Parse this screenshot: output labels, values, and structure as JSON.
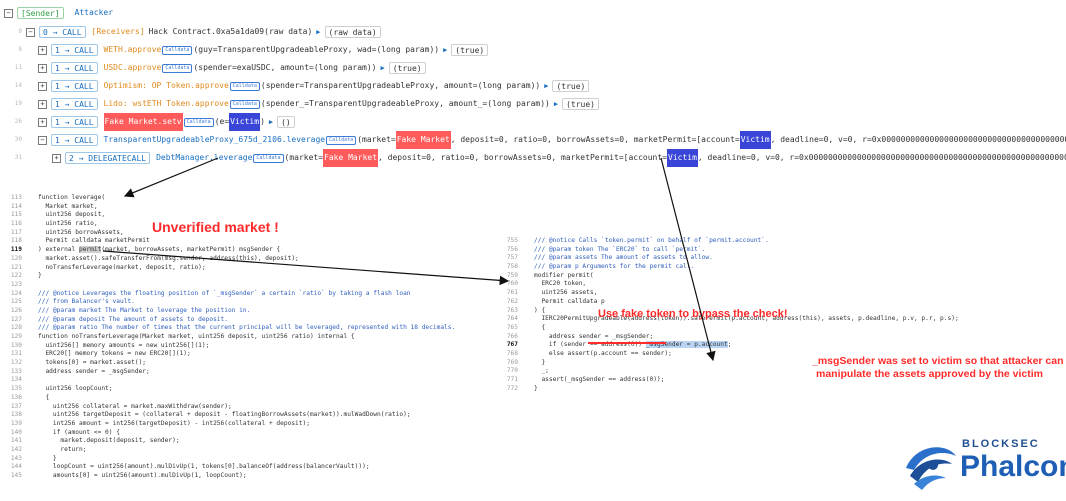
{
  "colors": {
    "accent_blue": "#1a6ec0",
    "call_orange": "#e08a1e",
    "highlight_red": "#ff5b5b",
    "highlight_victim": "#3845d6",
    "annotation_red": "#ff2a2a",
    "brand_blue": "#1e5fb5"
  },
  "trace": {
    "header": {
      "sender": "[Sender]",
      "attacker": "Attacker"
    },
    "calldata_badge": "Calldata",
    "rows": [
      {
        "line": "0",
        "toggle": "−",
        "idx": "0",
        "op": "CALL",
        "head": "[Receivers]",
        "fn": "Hack Contract.0xa5a1da09",
        "args": "(raw data)",
        "ret": "(raw data)"
      },
      {
        "line": "8",
        "toggle": "+",
        "idx": "1",
        "op": "CALL",
        "fn": "WETH.approve",
        "args": "(guy=TransparentUpgradeableProxy, wad=(long param))",
        "ret": "(true)"
      },
      {
        "line": "11",
        "toggle": "+",
        "idx": "1",
        "op": "CALL",
        "fn": "USDC.approve",
        "args": "(spender=exaUSDC, amount=(long param))",
        "ret": "(true)"
      },
      {
        "line": "14",
        "toggle": "+",
        "idx": "1",
        "op": "CALL",
        "fn": "Optimism: OP Token.approve",
        "args": "(spender=TransparentUpgradeableProxy, amount=(long param))",
        "ret": "(true)"
      },
      {
        "line": "19",
        "toggle": "+",
        "idx": "1",
        "op": "CALL",
        "fn": "Lido: wstETH Token.approve",
        "args": "(spender_=TransparentUpgradeableProxy, amount_=(long param))",
        "ret": "(true)"
      },
      {
        "line": "26",
        "toggle": "+",
        "idx": "1",
        "op": "CALL",
        "fn": "Fake Market.setv",
        "args_pre": "(e=",
        "args_victim": "Victim",
        "args_post": ")",
        "ret": "()"
      },
      {
        "line": "30",
        "toggle": "−",
        "idx": "1",
        "op": "CALL",
        "fn": "TransparentUpgradeableProxy_675d_2106.leverage",
        "a1": "(market=",
        "a2": "Fake Market",
        "a3": ", deposit=0, ratio=0, borrowAssets=0, marketPermit=[account=",
        "a4": "Victim",
        "a5": ", deadline=0, v=0, r=0x000000000000000000000000000000000000000000000000000000"
      },
      {
        "line": "31",
        "toggle": "+",
        "idx": "2",
        "op": "DELEGATECALL",
        "fn": "DebtManager.leverage",
        "a1": "(market=",
        "a2": "Fake Market",
        "a3": ", deposit=0, ratio=0, borrowAssets=0, marketPermit=[account=",
        "a4": "Victim",
        "a5": ", deadline=0, v=0, r=0x000000000000000000000000000000000000000000000000000000"
      }
    ]
  },
  "code_left": {
    "lines": [
      {
        "n": "113",
        "t": "function leverage("
      },
      {
        "n": "114",
        "t": "  Market market,"
      },
      {
        "n": "115",
        "t": "  uint256 deposit,"
      },
      {
        "n": "116",
        "t": "  uint256 ratio,"
      },
      {
        "n": "117",
        "t": "  uint256 borrowAssets,"
      },
      {
        "n": "118",
        "t": "  Permit calldata marketPermit"
      },
      {
        "n": "119",
        "t": ") external permit(market, borrowAssets, marketPermit) msgSender {"
      },
      {
        "n": "120",
        "t": "  market.asset().safeTransferFrom(msg.sender, address(this), deposit);"
      },
      {
        "n": "121",
        "t": "  noTransferLeverage(market, deposit, ratio);"
      },
      {
        "n": "122",
        "t": "}"
      },
      {
        "n": "123",
        "t": ""
      },
      {
        "n": "124",
        "t": "/// @notice Leverages the floating position of `_msgSender` a certain `ratio` by taking a flash loan"
      },
      {
        "n": "125",
        "t": "/// from Balancer's vault."
      },
      {
        "n": "126",
        "t": "/// @param market The Market to leverage the position in."
      },
      {
        "n": "127",
        "t": "/// @param deposit The amount of assets to deposit."
      },
      {
        "n": "128",
        "t": "/// @param ratio The number of times that the current principal will be leveraged, represented with 18 decimals."
      },
      {
        "n": "129",
        "t": "function noTransferLeverage(Market market, uint256 deposit, uint256 ratio) internal {"
      },
      {
        "n": "130",
        "t": "  uint256[] memory amounts = new uint256[](1);"
      },
      {
        "n": "131",
        "t": "  ERC20[] memory tokens = new ERC20[](1);"
      },
      {
        "n": "132",
        "t": "  tokens[0] = market.asset();"
      },
      {
        "n": "133",
        "t": "  address sender = _msgSender;"
      },
      {
        "n": "134",
        "t": ""
      },
      {
        "n": "135",
        "t": "  uint256 loopCount;"
      },
      {
        "n": "136",
        "t": "  {"
      },
      {
        "n": "137",
        "t": "    uint256 collateral = market.maxWithdraw(sender);"
      },
      {
        "n": "138",
        "t": "    uint256 targetDeposit = (collateral + deposit - floatingBorrowAssets(market)).mulWadDown(ratio);"
      },
      {
        "n": "139",
        "t": "    int256 amount = int256(targetDeposit) - int256(collateral + deposit);"
      },
      {
        "n": "140",
        "t": "    if (amount <= 0) {"
      },
      {
        "n": "141",
        "t": "      market.deposit(deposit, sender);"
      },
      {
        "n": "142",
        "t": "      return;"
      },
      {
        "n": "143",
        "t": "    }"
      },
      {
        "n": "144",
        "t": "    loopCount = uint256(amount).mulDivUp(1, tokens[0].balanceOf(address(balancerVault)));"
      },
      {
        "n": "145",
        "t": "    amounts[0] = uint256(amount).mulDivUp(1, loopCount);"
      }
    ]
  },
  "code_right": {
    "lines": [
      {
        "n": "755",
        "t": "/// @notice Calls `token.permit` on behalf of `permit.account`."
      },
      {
        "n": "756",
        "t": "/// @param token The `ERC20` to call `permit`."
      },
      {
        "n": "757",
        "t": "/// @param assets The amount of assets to allow."
      },
      {
        "n": "758",
        "t": "/// @param p Arguments for the permit call."
      },
      {
        "n": "759",
        "t": "modifier permit("
      },
      {
        "n": "760",
        "t": "  ERC20 token,"
      },
      {
        "n": "761",
        "t": "  uint256 assets,"
      },
      {
        "n": "762",
        "t": "  Permit calldata p"
      },
      {
        "n": "763",
        "t": ") {"
      },
      {
        "n": "764",
        "t": "  IERC20PermitUpgradeable(address(token)).safePermit(p.account, address(this), assets, p.deadline, p.v, p.r, p.s);"
      },
      {
        "n": "765",
        "t": "  {"
      },
      {
        "n": "766",
        "t": "    address sender = _msgSender;"
      },
      {
        "n": "767",
        "t": "    if (sender == address(0)) _msgSender = p.account;"
      },
      {
        "n": "768",
        "t": "    else assert(p.account == sender);"
      },
      {
        "n": "769",
        "t": "  }"
      },
      {
        "n": "770",
        "t": "  _;"
      },
      {
        "n": "771",
        "t": "  assert(_msgSender == address(0));"
      },
      {
        "n": "772",
        "t": "}"
      }
    ]
  },
  "annotations": {
    "unverified": "Unverified market !",
    "fake_token": "Use fake token to bypass the check!",
    "victim_line1": "_msgSender was set to victim so that attacker can",
    "victim_line2": "manipulate the assets approved by the victim"
  },
  "logo": {
    "word1": "BLOCKSEC",
    "word2": "Phalcon",
    "icon": "phalcon-eye-logo"
  }
}
